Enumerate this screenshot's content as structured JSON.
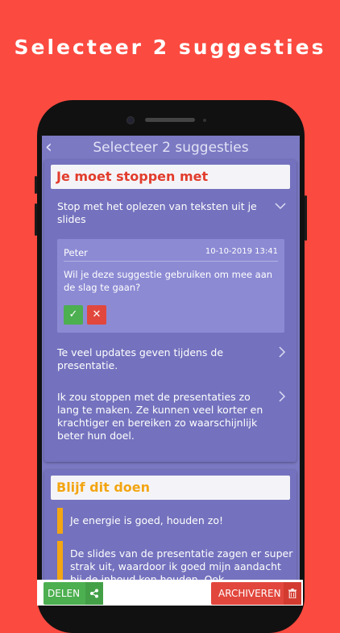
{
  "headline": "Selecteer 2 suggesties",
  "app": {
    "title": "Selecteer 2 suggesties"
  },
  "section_stop": {
    "header": "Je moet stoppen met",
    "items": [
      {
        "text": "Stop met het oplezen van teksten uit je slides",
        "expanded": true
      },
      {
        "text": "Te veel updates geven tijdens de presentatie.",
        "expanded": false
      },
      {
        "text": "Ik zou stoppen met de presentaties zo lang te maken. Ze kunnen veel korter en krachtiger en bereiken zo waarschijnlijk beter hun doel.",
        "expanded": false
      }
    ],
    "comment": {
      "author": "Peter",
      "date": "10-10-2019 13:41",
      "text": "Wil je deze suggestie gebruiken om mee aan de slag te gaan?"
    }
  },
  "section_keep": {
    "header": "Blijf dit doen",
    "items": [
      {
        "text": "Je energie is goed, houden zo!"
      },
      {
        "text": "De slides van de presentatie zagen er super strak uit, waardoor ik goed mijn aandacht bij de inhoud kon houden. Ook"
      }
    ]
  },
  "actions": {
    "share_label": "DELEN",
    "archive_label": "ARCHIVEREN"
  },
  "colors": {
    "background": "#fb4a40",
    "screen": "#7b79c2",
    "stop_accent": "#e23c2c",
    "keep_accent": "#f3a512",
    "accept": "#4caf50",
    "reject": "#e2473d"
  },
  "icons": [
    "back-chevron-icon",
    "chevron-down-icon",
    "chevron-right-icon",
    "checkmark-icon",
    "close-icon",
    "share-icon",
    "trash-icon"
  ]
}
